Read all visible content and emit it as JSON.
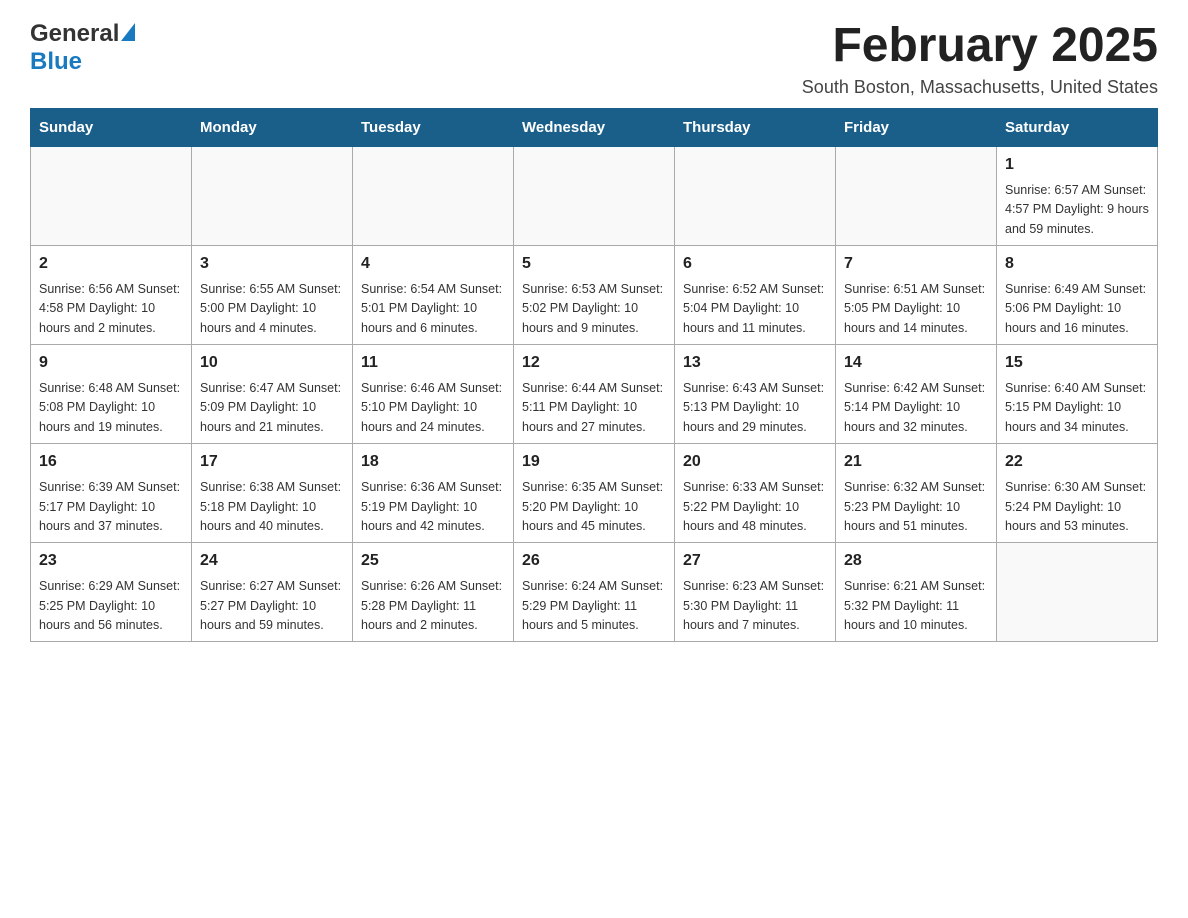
{
  "header": {
    "logo": {
      "general_text": "General",
      "blue_text": "Blue"
    },
    "title": "February 2025",
    "location": "South Boston, Massachusetts, United States"
  },
  "calendar": {
    "days_of_week": [
      "Sunday",
      "Monday",
      "Tuesday",
      "Wednesday",
      "Thursday",
      "Friday",
      "Saturday"
    ],
    "weeks": [
      [
        {
          "day": "",
          "info": ""
        },
        {
          "day": "",
          "info": ""
        },
        {
          "day": "",
          "info": ""
        },
        {
          "day": "",
          "info": ""
        },
        {
          "day": "",
          "info": ""
        },
        {
          "day": "",
          "info": ""
        },
        {
          "day": "1",
          "info": "Sunrise: 6:57 AM\nSunset: 4:57 PM\nDaylight: 9 hours\nand 59 minutes."
        }
      ],
      [
        {
          "day": "2",
          "info": "Sunrise: 6:56 AM\nSunset: 4:58 PM\nDaylight: 10 hours\nand 2 minutes."
        },
        {
          "day": "3",
          "info": "Sunrise: 6:55 AM\nSunset: 5:00 PM\nDaylight: 10 hours\nand 4 minutes."
        },
        {
          "day": "4",
          "info": "Sunrise: 6:54 AM\nSunset: 5:01 PM\nDaylight: 10 hours\nand 6 minutes."
        },
        {
          "day": "5",
          "info": "Sunrise: 6:53 AM\nSunset: 5:02 PM\nDaylight: 10 hours\nand 9 minutes."
        },
        {
          "day": "6",
          "info": "Sunrise: 6:52 AM\nSunset: 5:04 PM\nDaylight: 10 hours\nand 11 minutes."
        },
        {
          "day": "7",
          "info": "Sunrise: 6:51 AM\nSunset: 5:05 PM\nDaylight: 10 hours\nand 14 minutes."
        },
        {
          "day": "8",
          "info": "Sunrise: 6:49 AM\nSunset: 5:06 PM\nDaylight: 10 hours\nand 16 minutes."
        }
      ],
      [
        {
          "day": "9",
          "info": "Sunrise: 6:48 AM\nSunset: 5:08 PM\nDaylight: 10 hours\nand 19 minutes."
        },
        {
          "day": "10",
          "info": "Sunrise: 6:47 AM\nSunset: 5:09 PM\nDaylight: 10 hours\nand 21 minutes."
        },
        {
          "day": "11",
          "info": "Sunrise: 6:46 AM\nSunset: 5:10 PM\nDaylight: 10 hours\nand 24 minutes."
        },
        {
          "day": "12",
          "info": "Sunrise: 6:44 AM\nSunset: 5:11 PM\nDaylight: 10 hours\nand 27 minutes."
        },
        {
          "day": "13",
          "info": "Sunrise: 6:43 AM\nSunset: 5:13 PM\nDaylight: 10 hours\nand 29 minutes."
        },
        {
          "day": "14",
          "info": "Sunrise: 6:42 AM\nSunset: 5:14 PM\nDaylight: 10 hours\nand 32 minutes."
        },
        {
          "day": "15",
          "info": "Sunrise: 6:40 AM\nSunset: 5:15 PM\nDaylight: 10 hours\nand 34 minutes."
        }
      ],
      [
        {
          "day": "16",
          "info": "Sunrise: 6:39 AM\nSunset: 5:17 PM\nDaylight: 10 hours\nand 37 minutes."
        },
        {
          "day": "17",
          "info": "Sunrise: 6:38 AM\nSunset: 5:18 PM\nDaylight: 10 hours\nand 40 minutes."
        },
        {
          "day": "18",
          "info": "Sunrise: 6:36 AM\nSunset: 5:19 PM\nDaylight: 10 hours\nand 42 minutes."
        },
        {
          "day": "19",
          "info": "Sunrise: 6:35 AM\nSunset: 5:20 PM\nDaylight: 10 hours\nand 45 minutes."
        },
        {
          "day": "20",
          "info": "Sunrise: 6:33 AM\nSunset: 5:22 PM\nDaylight: 10 hours\nand 48 minutes."
        },
        {
          "day": "21",
          "info": "Sunrise: 6:32 AM\nSunset: 5:23 PM\nDaylight: 10 hours\nand 51 minutes."
        },
        {
          "day": "22",
          "info": "Sunrise: 6:30 AM\nSunset: 5:24 PM\nDaylight: 10 hours\nand 53 minutes."
        }
      ],
      [
        {
          "day": "23",
          "info": "Sunrise: 6:29 AM\nSunset: 5:25 PM\nDaylight: 10 hours\nand 56 minutes."
        },
        {
          "day": "24",
          "info": "Sunrise: 6:27 AM\nSunset: 5:27 PM\nDaylight: 10 hours\nand 59 minutes."
        },
        {
          "day": "25",
          "info": "Sunrise: 6:26 AM\nSunset: 5:28 PM\nDaylight: 11 hours\nand 2 minutes."
        },
        {
          "day": "26",
          "info": "Sunrise: 6:24 AM\nSunset: 5:29 PM\nDaylight: 11 hours\nand 5 minutes."
        },
        {
          "day": "27",
          "info": "Sunrise: 6:23 AM\nSunset: 5:30 PM\nDaylight: 11 hours\nand 7 minutes."
        },
        {
          "day": "28",
          "info": "Sunrise: 6:21 AM\nSunset: 5:32 PM\nDaylight: 11 hours\nand 10 minutes."
        },
        {
          "day": "",
          "info": ""
        }
      ]
    ]
  }
}
